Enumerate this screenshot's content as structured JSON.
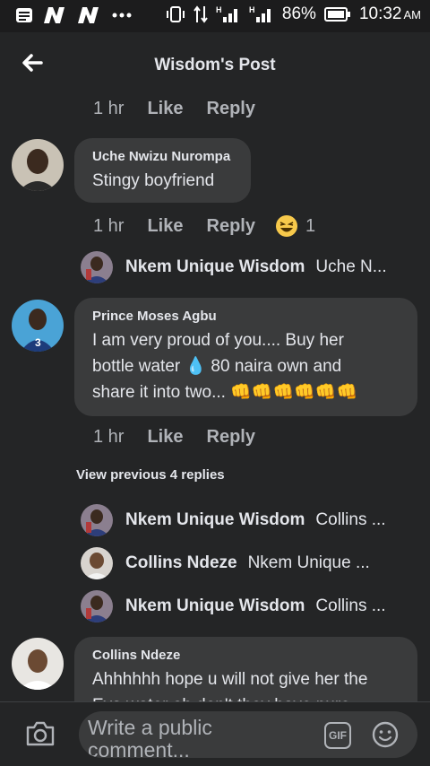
{
  "status_bar": {
    "battery_percent": "86%",
    "time": "10:32",
    "time_suffix": "AM",
    "network_label": "H"
  },
  "header": {
    "title": "Wisdom's Post"
  },
  "comments": [
    {
      "time": "1 hr",
      "like": "Like",
      "reply": "Reply"
    },
    {
      "author": "Uche Nwizu Nurompa",
      "text": "Stingy boyfriend",
      "time": "1 hr",
      "like": "Like",
      "reply": "Reply",
      "reaction_count": "1",
      "reaction_icon": "haha-emoji"
    },
    {
      "author": "Prince Moses Agbu",
      "text_lines": [
        "I am very proud of you.... Buy her",
        "bottle water 💧 80 naira own and",
        "share it into two... 👊👊👊👊👊👊"
      ],
      "time": "1 hr",
      "like": "Like",
      "reply": "Reply"
    },
    {
      "author": "Collins Ndeze",
      "text_lines": [
        "Ahhhhhh hope u will not give her the",
        "Eva water oh don't they have pure"
      ]
    }
  ],
  "replies_top": [
    {
      "name": "Nkem Unique Wisdom",
      "preview": "Uche N..."
    }
  ],
  "view_previous": "View previous 4 replies",
  "replies": [
    {
      "name": "Nkem Unique Wisdom",
      "preview": "Collins ..."
    },
    {
      "name": "Collins Ndeze",
      "preview": "Nkem Unique ..."
    },
    {
      "name": "Nkem Unique Wisdom",
      "preview": "Collins ..."
    }
  ],
  "composer": {
    "placeholder": "Write a public comment...",
    "gif_label": "GIF"
  },
  "colors": {
    "background": "#242526",
    "bubble": "#3a3b3c",
    "muted_text": "#b0b3b8",
    "text": "#e4e6eb"
  }
}
